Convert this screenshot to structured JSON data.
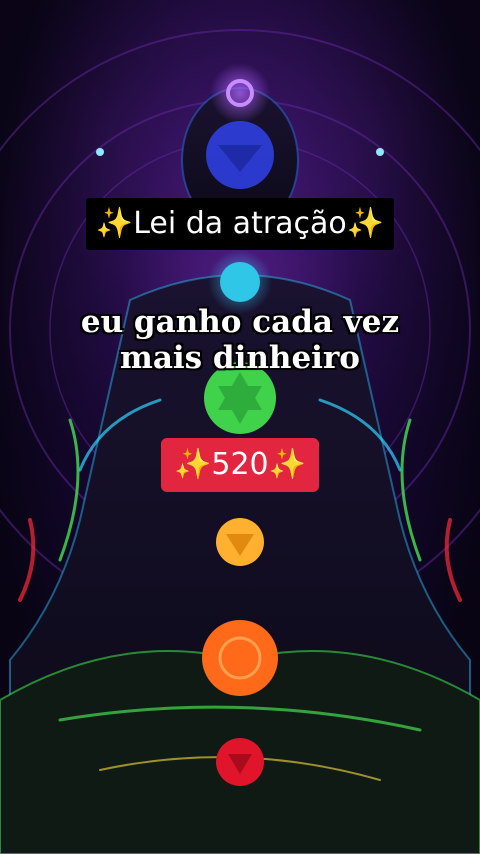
{
  "video": {
    "title_prefix": "✨",
    "title": "Lei da atração",
    "title_suffix": "✨",
    "affirmation_line1": "eu ganho cada vez",
    "affirmation_line2": "mais dinheiro",
    "count_prefix": "✨",
    "count": "520",
    "count_suffix": "✨"
  },
  "colors": {
    "badge": "#e2263f",
    "crown": "#8a2be2",
    "third_eye": "#3a4dff",
    "throat": "#2fc6e8",
    "heart": "#3fd24a",
    "solar": "#ffb02e",
    "sacral": "#ff6a1a",
    "root": "#e0142a"
  },
  "icons": [
    "sparkles-icon",
    "chakra-crown-icon",
    "chakra-third-eye-icon",
    "chakra-throat-icon",
    "chakra-heart-icon",
    "chakra-solar-plexus-icon",
    "chakra-sacral-icon",
    "chakra-root-icon"
  ]
}
